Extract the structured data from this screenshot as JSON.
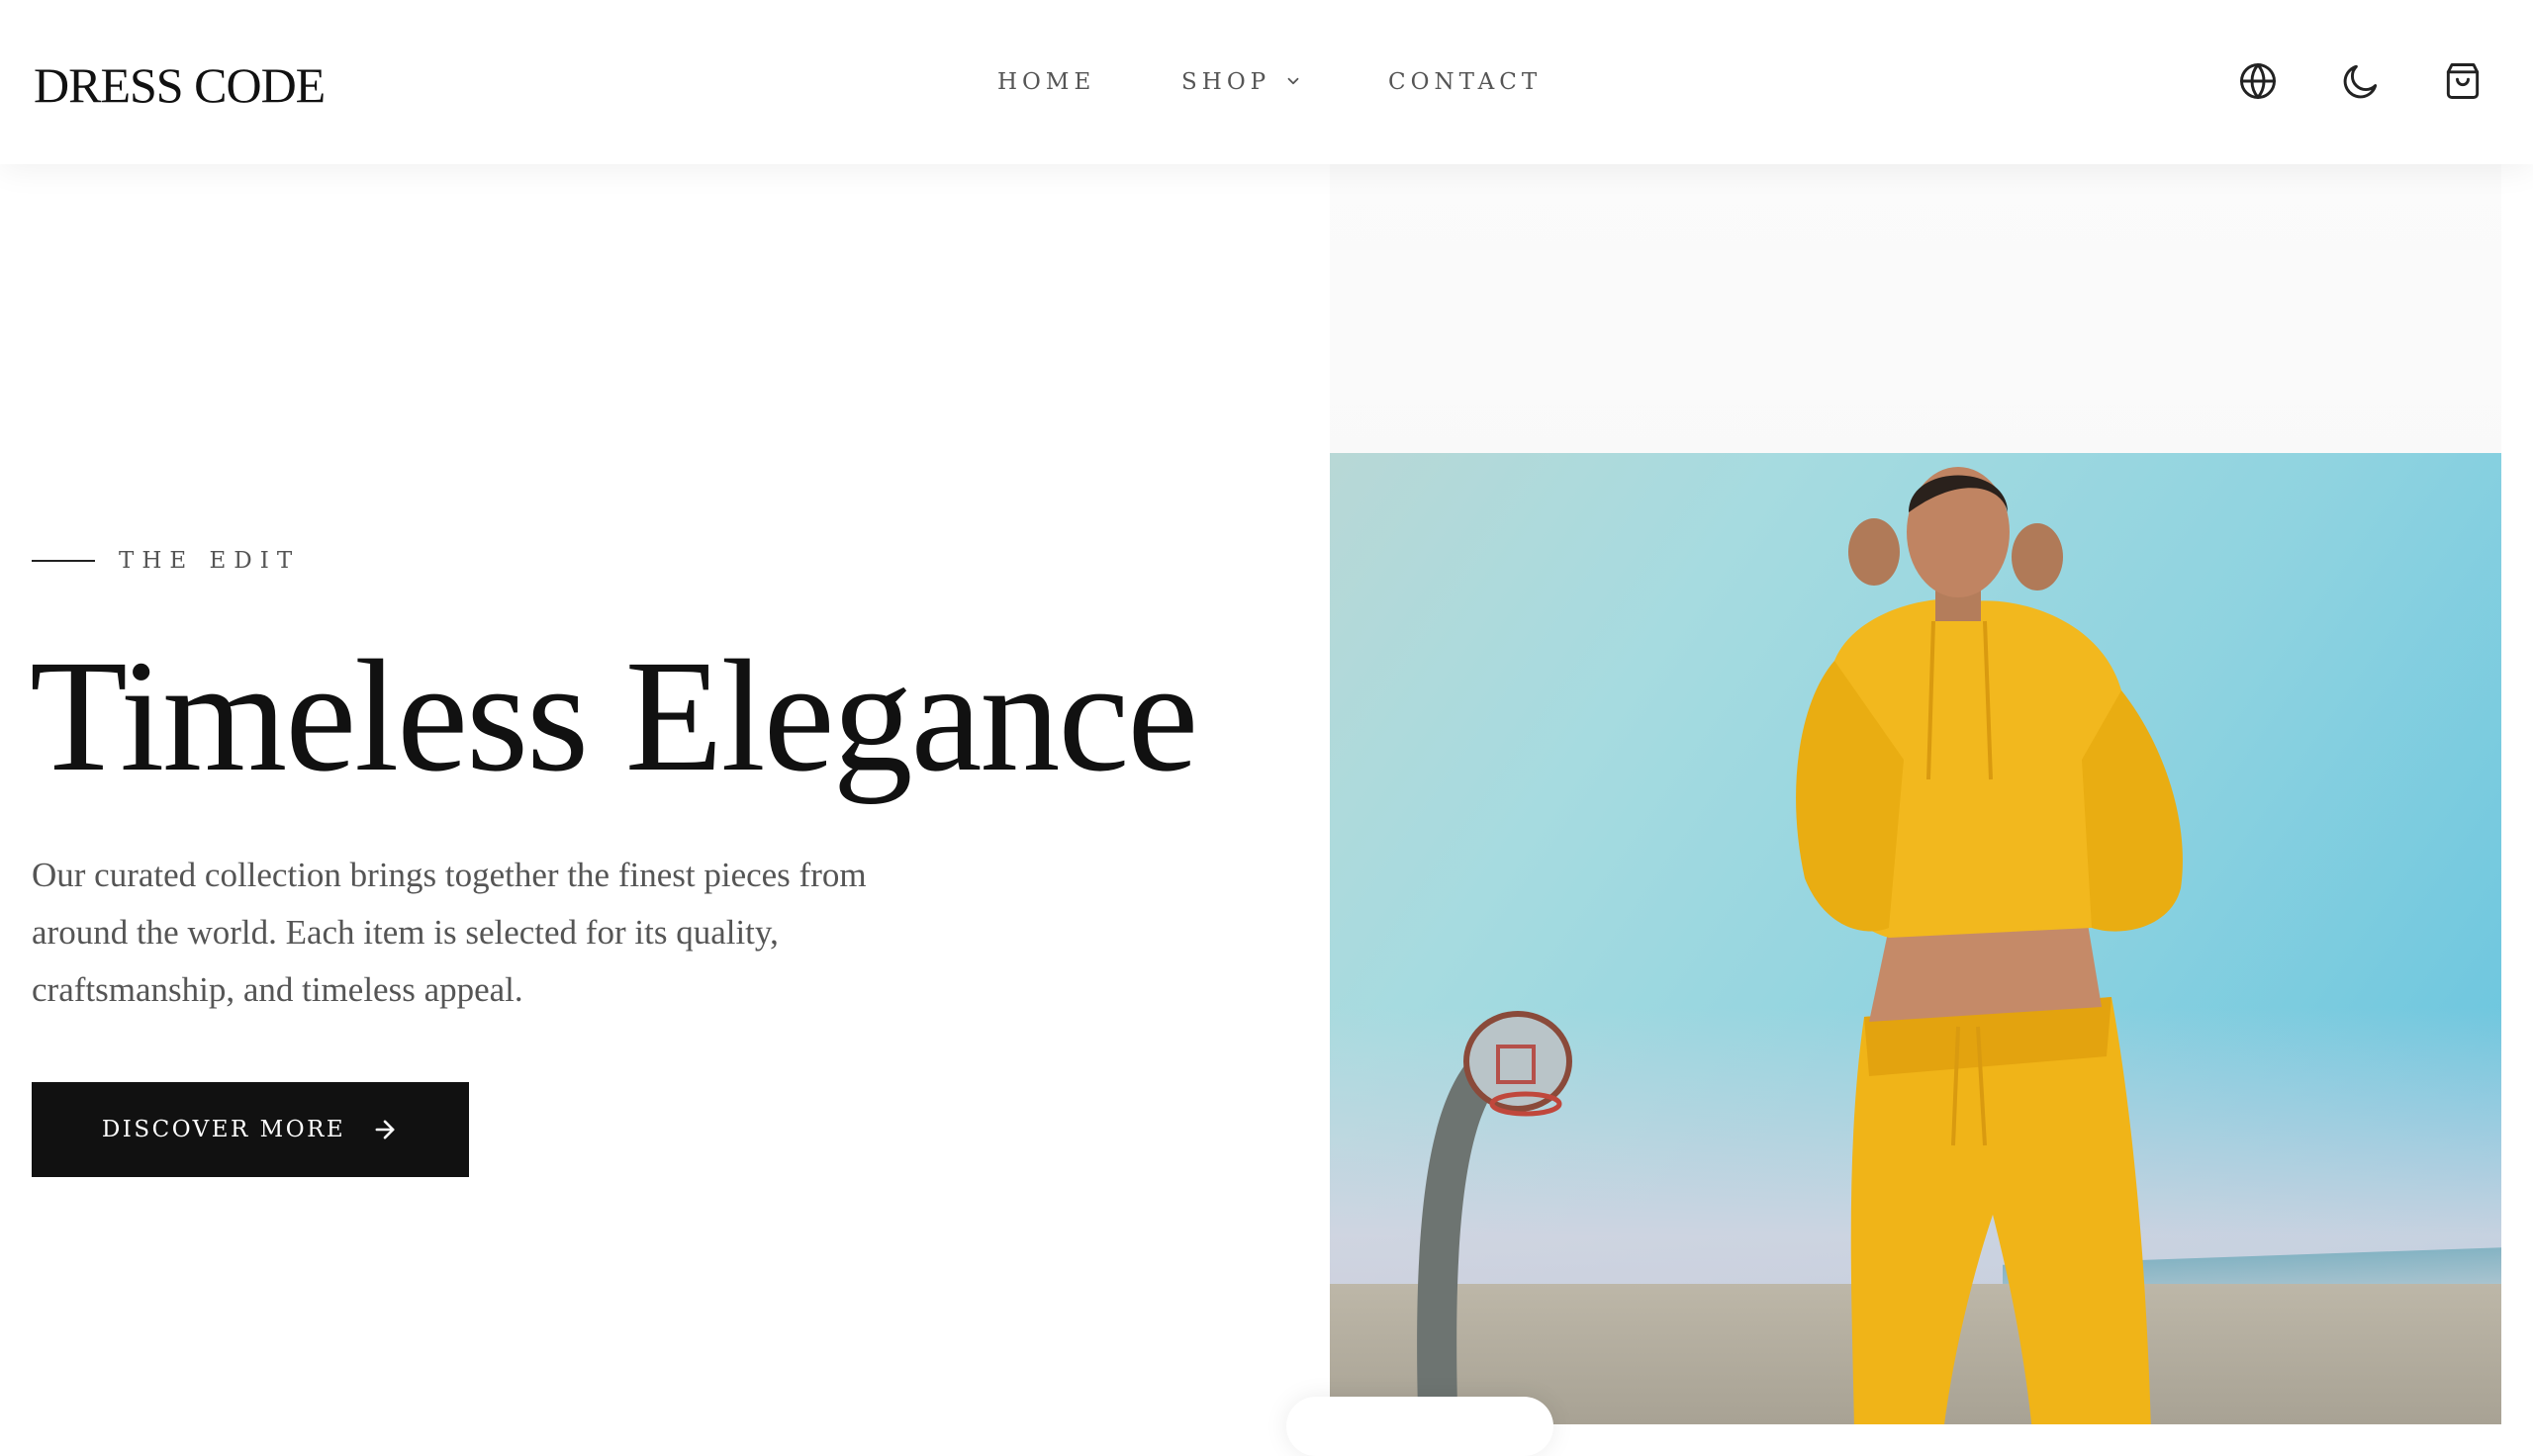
{
  "brand": {
    "logo_text": "DRESS CODE"
  },
  "nav": {
    "items": [
      {
        "label": "HOME"
      },
      {
        "label": "SHOP",
        "has_dropdown": true
      },
      {
        "label": "CONTACT"
      }
    ]
  },
  "header_icons": [
    "globe-icon",
    "moon-icon",
    "shopping-bag-icon"
  ],
  "hero": {
    "eyebrow": "THE EDIT",
    "title": "Timeless Elegance",
    "description": "Our curated collection brings together the finest pieces from around the world. Each item is selected for its quality, craftsmanship, and timeless appeal.",
    "cta_label": "DISCOVER MORE",
    "cta_icon": "arrow-right-icon"
  },
  "colors": {
    "text_primary": "#111111",
    "text_secondary": "#555555",
    "button_bg": "#111111",
    "button_text": "#ffffff",
    "outfit_yellow": "#f2b81e",
    "sky_blue": "#5fc1de"
  }
}
